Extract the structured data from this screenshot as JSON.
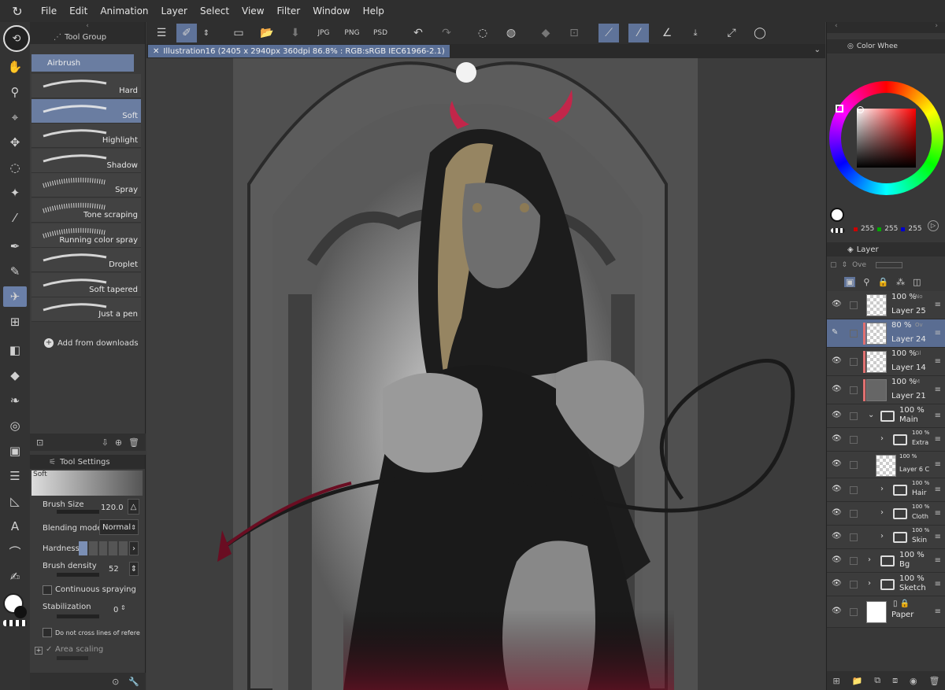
{
  "menubar": {
    "items": [
      "File",
      "Edit",
      "Animation",
      "Layer",
      "Select",
      "View",
      "Filter",
      "Window",
      "Help"
    ]
  },
  "subtool": {
    "group_label": "Tool Group",
    "active_group": "Airbrush",
    "brushes": [
      "Hard",
      "Soft",
      "Highlight",
      "Shadow",
      "Spray",
      "Tone scraping",
      "Running color spray",
      "Droplet",
      "Soft tapered",
      "Just a pen"
    ],
    "selected_brush": "Soft",
    "add_from_downloads": "Add from downloads"
  },
  "tool_settings": {
    "title": "Tool Settings",
    "preview_label": "Soft",
    "brush_size_label": "Brush Size",
    "brush_size_value": "120.0",
    "blending_mode_label": "Blending mode",
    "blending_mode_value": "Normal",
    "hardness_label": "Hardness",
    "brush_density_label": "Brush density",
    "brush_density_value": "52",
    "continuous_spraying_label": "Continuous spraying",
    "stabilization_label": "Stabilization",
    "stabilization_value": "0",
    "ref_layer_label": "Do not cross lines of reference lay",
    "area_scaling_label": "Area scaling"
  },
  "document": {
    "tab_title": "Illustration16 (2405 x 2940px 360dpi 86.8% : RGB:sRGB IEC61966-2.1)"
  },
  "color": {
    "panel_title": "Color Whee",
    "r": "255",
    "g": "255",
    "b": "255",
    "selected_hex": "#ffffff"
  },
  "layers": {
    "panel_title": "Layer",
    "blend_placeholder": "Ove",
    "rows": [
      {
        "pct": "100 %",
        "mode": "No",
        "name": "Layer 25",
        "type": "raster"
      },
      {
        "pct": "80 %",
        "mode": "Ov",
        "name": "Layer 24",
        "type": "raster"
      },
      {
        "pct": "100 %",
        "mode": "Gl",
        "name": "Layer 14",
        "type": "raster"
      },
      {
        "pct": "100 %",
        "mode": "M",
        "name": "Layer 21",
        "type": "raster"
      },
      {
        "pct": "100 %",
        "mode": "",
        "name": "Main",
        "type": "folder"
      },
      {
        "pct": "100 %",
        "mode": "",
        "name": "Extra",
        "type": "folder"
      },
      {
        "pct": "100 %",
        "mode": "",
        "name": "Layer 6 C",
        "type": "raster"
      },
      {
        "pct": "100 %",
        "mode": "",
        "name": "Hair",
        "type": "folder"
      },
      {
        "pct": "100 %",
        "mode": "",
        "name": "Cloth",
        "type": "folder"
      },
      {
        "pct": "100 %",
        "mode": "",
        "name": "Skin",
        "type": "folder"
      },
      {
        "pct": "100 %",
        "mode": "",
        "name": "Bg",
        "type": "folder"
      },
      {
        "pct": "100 %",
        "mode": "",
        "name": "Sketch",
        "type": "folder"
      },
      {
        "pct": "",
        "mode": "",
        "name": "Paper",
        "type": "paper"
      }
    ]
  }
}
